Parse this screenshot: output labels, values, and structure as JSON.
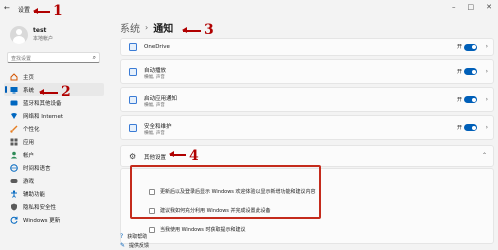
{
  "window": {
    "app_title": "设置",
    "controls": [
      "–",
      "□",
      "✕"
    ]
  },
  "user": {
    "name": "test",
    "account_type": "本地帐户"
  },
  "search": {
    "placeholder": "查找设置"
  },
  "sidebar": {
    "items": [
      {
        "label": "主页",
        "icon": "home-icon",
        "color": "#d35400"
      },
      {
        "label": "系统",
        "icon": "system-icon",
        "color": "#0067c0",
        "active": true
      },
      {
        "label": "蓝牙和其他设备",
        "icon": "bluetooth-icon",
        "color": "#0067c0"
      },
      {
        "label": "网络和 Internet",
        "icon": "network-icon",
        "color": "#0067c0"
      },
      {
        "label": "个性化",
        "icon": "brush-icon",
        "color": "#e67e22"
      },
      {
        "label": "应用",
        "icon": "apps-icon",
        "color": "#5a5a5a"
      },
      {
        "label": "帐户",
        "icon": "account-icon",
        "color": "#2e8b57"
      },
      {
        "label": "时间和语言",
        "icon": "globe-icon",
        "color": "#0067c0"
      },
      {
        "label": "游戏",
        "icon": "gamepad-icon",
        "color": "#5a5a5a"
      },
      {
        "label": "辅助功能",
        "icon": "accessibility-icon",
        "color": "#0067c0"
      },
      {
        "label": "隐私和安全性",
        "icon": "shield-icon",
        "color": "#5a5a5a"
      },
      {
        "label": "Windows 更新",
        "icon": "update-icon",
        "color": "#0067c0"
      }
    ]
  },
  "breadcrumb": {
    "parent": "系统",
    "separator": "›",
    "current": "通知"
  },
  "apps": [
    {
      "name": "OneDrive",
      "sub": "",
      "state": "开"
    },
    {
      "name": "自动播放",
      "sub": "横幅, 声音",
      "state": "开"
    },
    {
      "name": "启动应用通知",
      "sub": "横幅, 声音",
      "state": "开"
    },
    {
      "name": "安全和维护",
      "sub": "横幅, 声音",
      "state": "开"
    }
  ],
  "other_settings": {
    "title": "其他设置",
    "options": [
      "更新后以及登录后显示 Windows 欢迎体验以显示新增功能和建议内容",
      "建议我如何充分利用 Windows 并完成设置此设备",
      "当我使用 Windows 时获取提示和建议"
    ]
  },
  "footer_links": [
    {
      "label": "获取帮助",
      "icon": "help-icon"
    },
    {
      "label": "提供反馈",
      "icon": "feedback-icon"
    }
  ],
  "annotations": [
    "1",
    "2",
    "3",
    "4"
  ],
  "accent_color": "#005fb8",
  "annotation_color": "#b00000"
}
